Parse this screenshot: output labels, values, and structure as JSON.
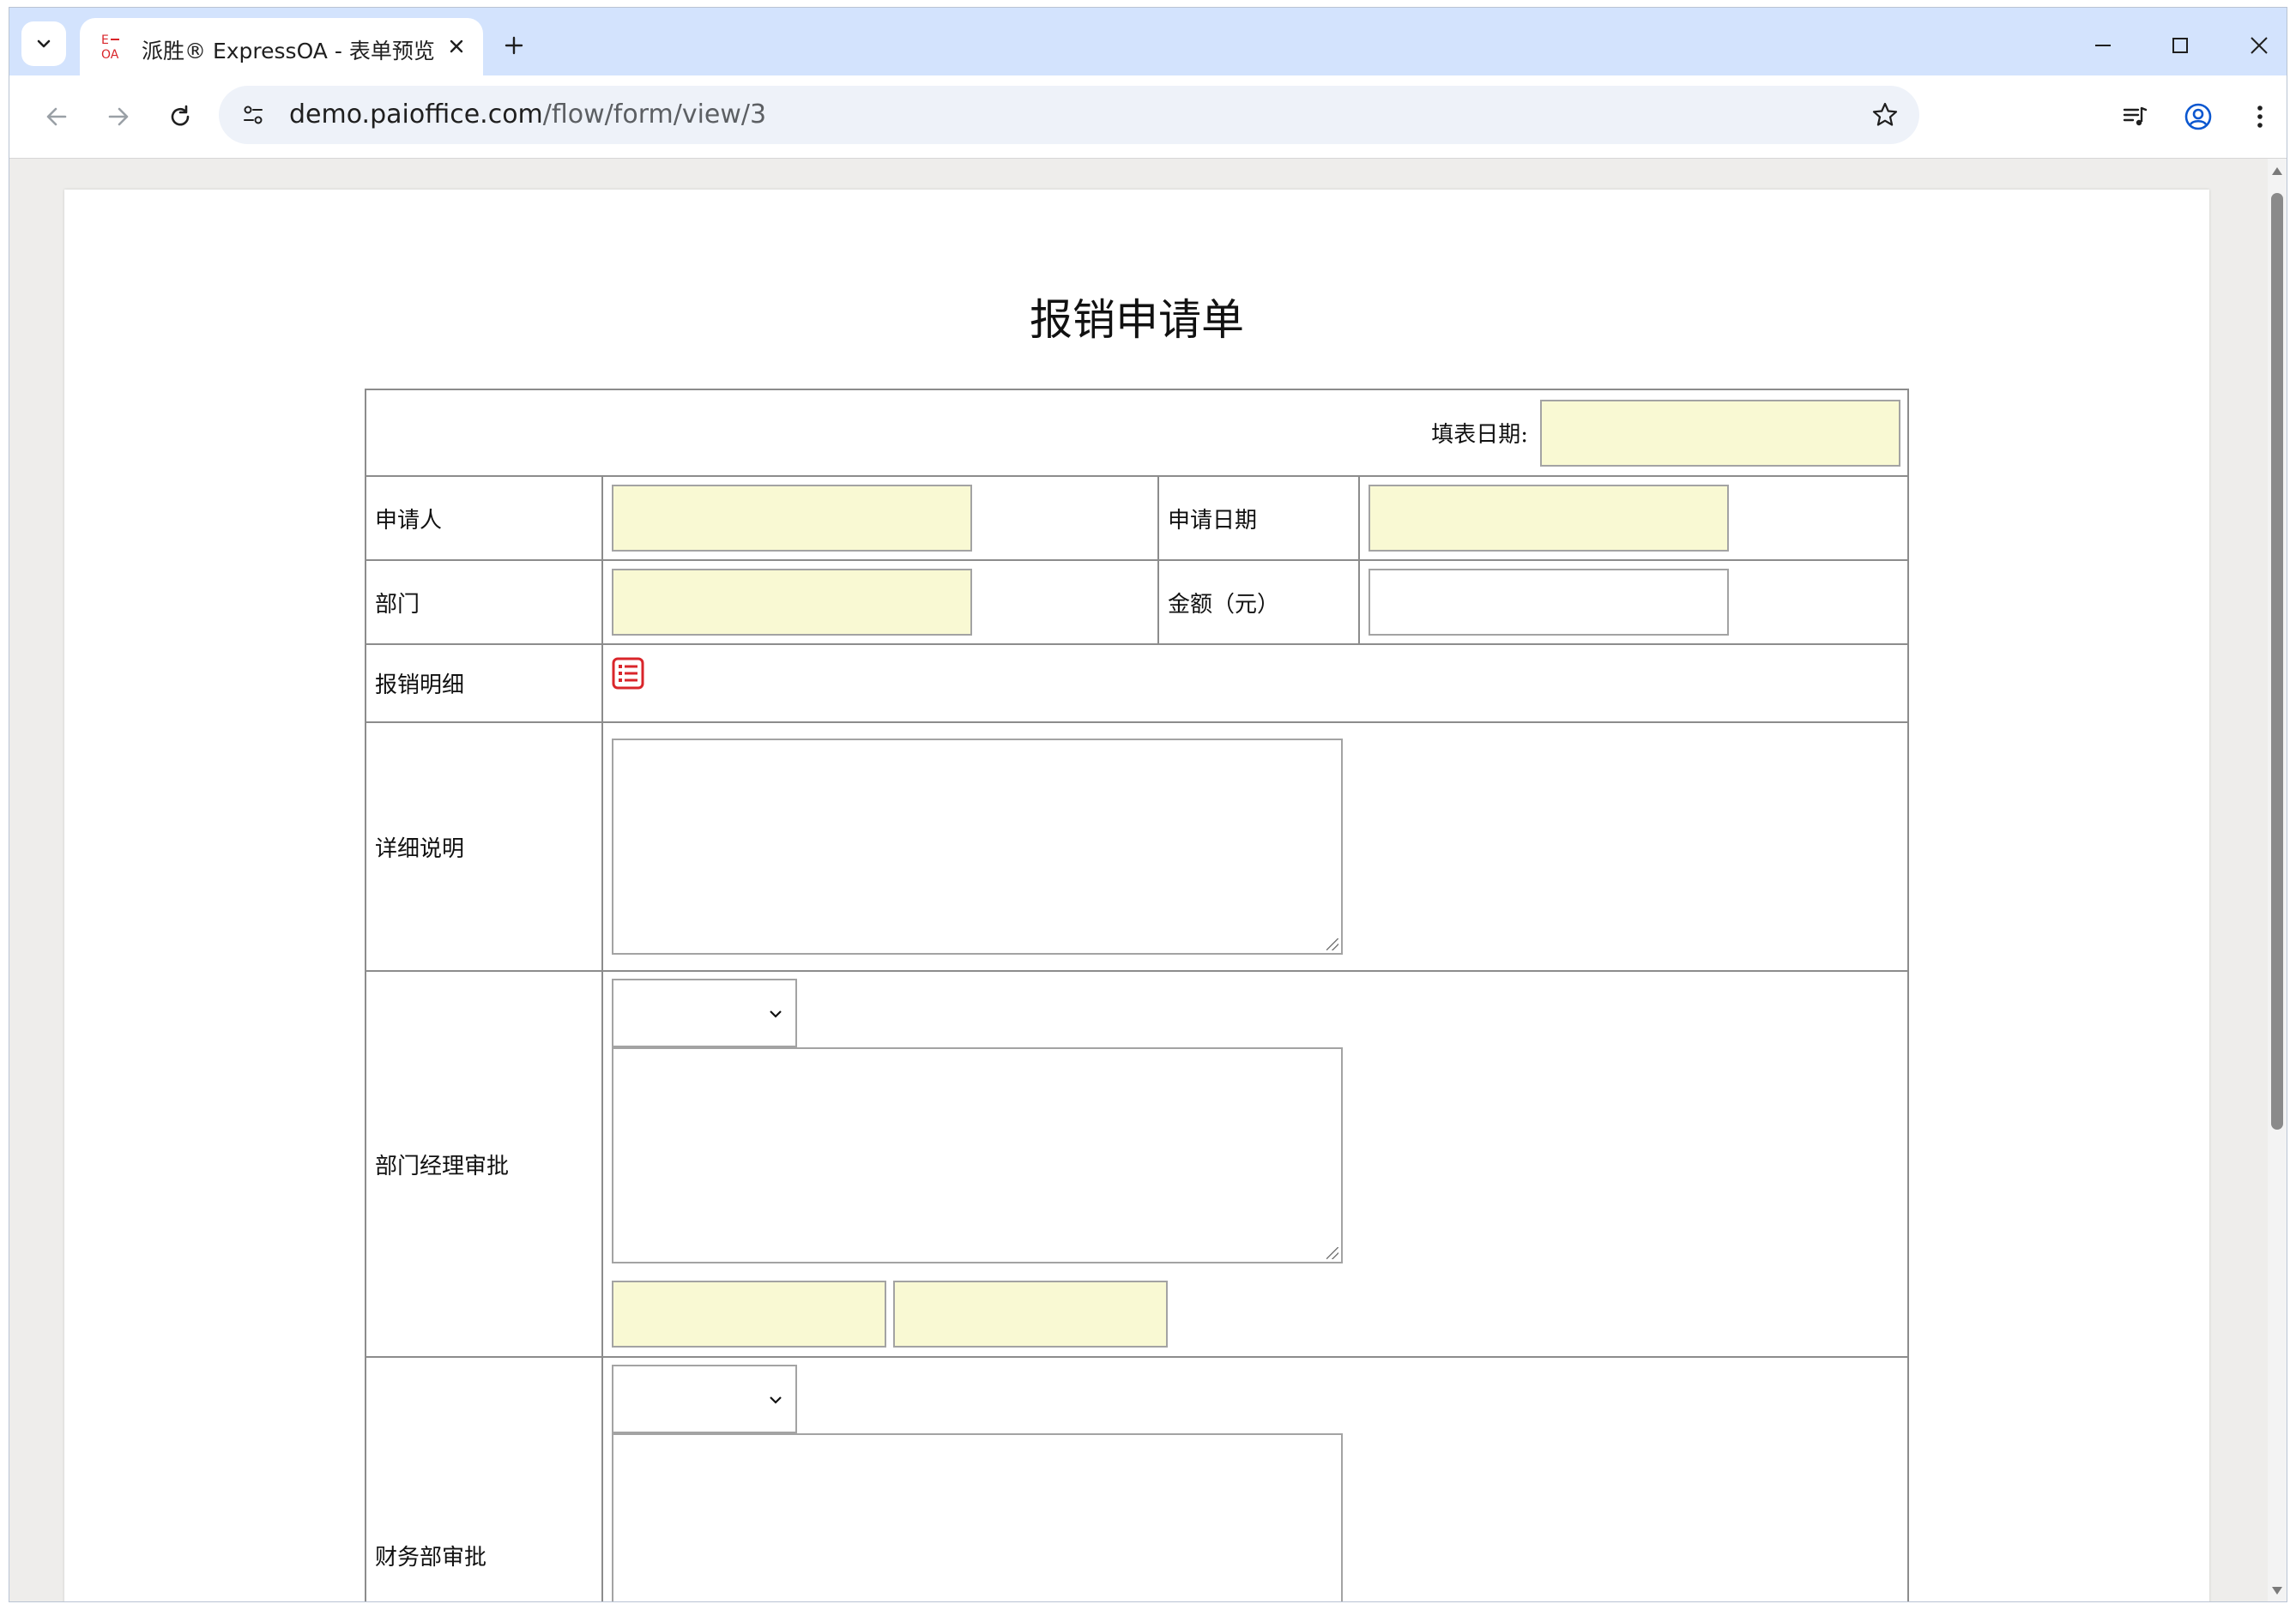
{
  "browser": {
    "tab": {
      "title": "派胜® ExpressOA - 表单预览 - 派胜"
    },
    "url": {
      "host": "demo.paioffice.com",
      "path": "/flow/form/view/3"
    }
  },
  "form": {
    "title": "报销申请单",
    "fill_date_label": "填表日期:",
    "fields": {
      "applicant_label": "申请人",
      "apply_date_label": "申请日期",
      "department_label": "部门",
      "amount_label": "金额（元）",
      "expense_detail_label": "报销明细",
      "description_label": "详细说明",
      "manager_approval_label": "部门经理审批",
      "finance_approval_label": "财务部审批"
    },
    "colors": {
      "readonly_field": "#f9f9d3",
      "detail_icon": "#d9252a"
    },
    "icons": {
      "expense_detail": "list-icon"
    }
  }
}
